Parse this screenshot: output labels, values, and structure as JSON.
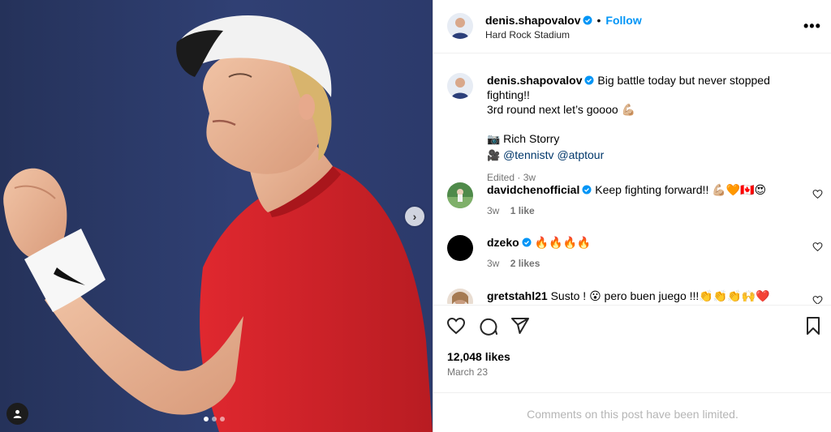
{
  "photo": {
    "carousel_dots": [
      true,
      false,
      false
    ]
  },
  "post": {
    "username": "denis.shapovalov",
    "follow_label": "Follow",
    "separator": "•",
    "location": "Hard Rock Stadium",
    "more_label": "•••",
    "caption": {
      "text_line1": "Big battle today but never stopped fighting!!",
      "text_line2": "3rd round next let’s goooo 💪🏼",
      "camera_emoji": "📷",
      "photographer": "Rich Storry",
      "video_emoji": "🎥",
      "mention1": "@tennistv",
      "mention2": "@atptour",
      "edited": "Edited · 3w"
    }
  },
  "comments": [
    {
      "username": "davidchenofficial",
      "verified": true,
      "text": "Keep fighting forward!! 💪🏼🧡🇨🇦😍",
      "time": "3w",
      "likes": "1 like"
    },
    {
      "username": "dzeko",
      "verified": true,
      "text": "🔥🔥🔥🔥",
      "time": "3w",
      "likes": "2 likes"
    },
    {
      "username": "gretstahl21",
      "verified": false,
      "text": "Susto ! 😮 pero buen juego !!!👏👏👏🙌❤️"
    }
  ],
  "footer": {
    "likes": "12,048 likes",
    "date": "March 23",
    "limited": "Comments on this post have been limited."
  },
  "colors": {
    "accent": "#0095f6",
    "verified": "#0095f6",
    "shirt": "#d9262c",
    "background_photo": "#2d3b6e"
  },
  "icons": [
    "more-icon",
    "verified-icon",
    "heart-icon",
    "comment-icon",
    "share-icon",
    "bookmark-icon",
    "chevron-right-icon",
    "user-tag-icon"
  ]
}
